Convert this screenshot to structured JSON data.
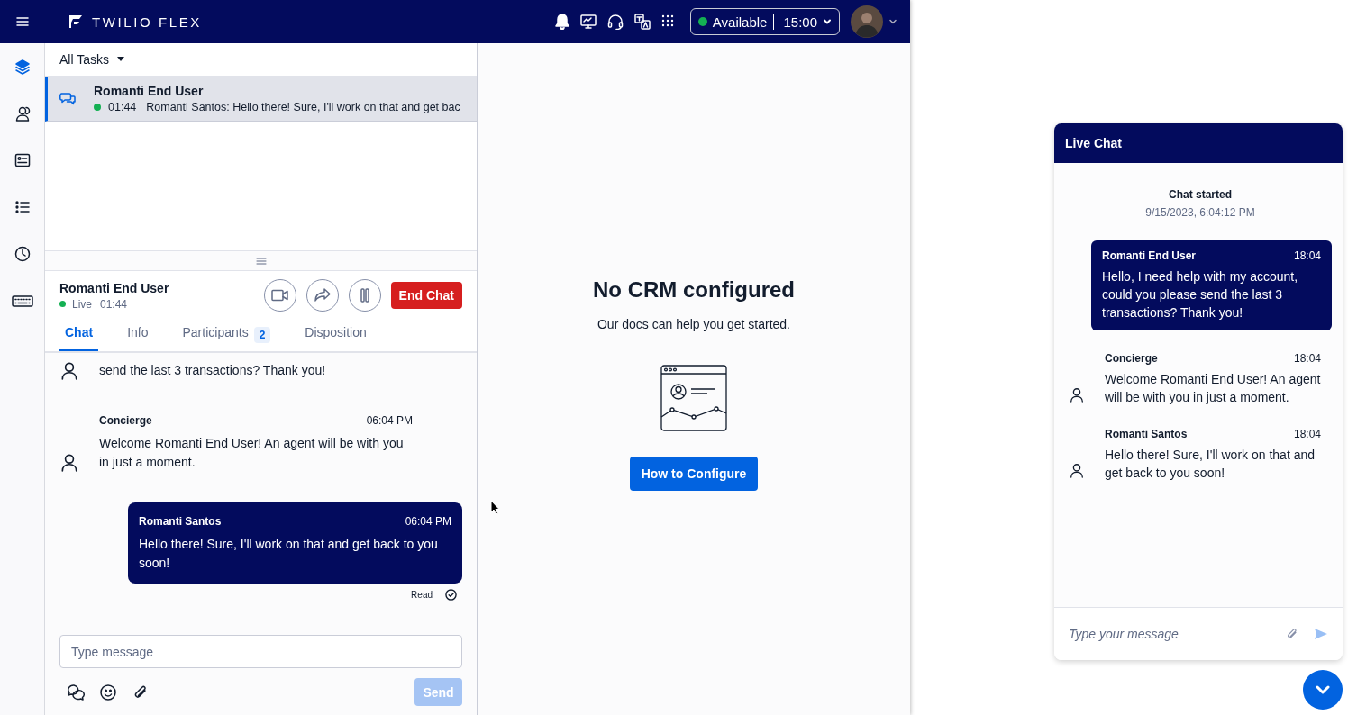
{
  "topbar": {
    "brand": "TWILIO FLEX",
    "status": {
      "label": "Available",
      "timer": "15:00",
      "available": true
    }
  },
  "sidebar": {
    "items": [
      {
        "kind": "layers",
        "selected": true
      },
      {
        "kind": "contacts",
        "selected": false
      },
      {
        "kind": "card",
        "selected": false
      },
      {
        "kind": "list",
        "selected": false
      },
      {
        "kind": "clock",
        "selected": false
      },
      {
        "kind": "keyboard",
        "selected": false
      }
    ]
  },
  "task_list": {
    "filter": "All Tasks",
    "tasks": [
      {
        "title": "Romanti End User",
        "time": "01:44",
        "preview": "Romanti Santos: Hello there! Sure, I'll work on that and get bac",
        "live": true,
        "selected": true
      }
    ]
  },
  "chat": {
    "customer": "Romanti End User",
    "status": "Live",
    "timer": "01:44",
    "live": true,
    "end_button": "End Chat",
    "tabs": [
      {
        "label": "Chat",
        "selected": true
      },
      {
        "label": "Info",
        "selected": false
      },
      {
        "label": "Participants",
        "count": "2",
        "selected": false
      },
      {
        "label": "Disposition",
        "selected": false
      }
    ],
    "messages": [
      {
        "kind": "inbound",
        "text": "send the last 3 transactions? Thank you!"
      },
      {
        "kind": "inbound",
        "author": "Concierge",
        "time": "06:04 PM",
        "text": "Welcome Romanti End User! An agent will be with you in just a moment."
      },
      {
        "kind": "outbound",
        "author": "Romanti Santos",
        "time": "06:04 PM",
        "text": "Hello there! Sure, I'll work on that and get back to you soon!",
        "receipt": "Read"
      }
    ],
    "input": {
      "placeholder": "Type message"
    },
    "send_button": {
      "label": "Send",
      "disabled": true
    }
  },
  "crm": {
    "title": "No CRM configured",
    "subtitle": "Our docs can help you get started.",
    "button": "How to Configure"
  },
  "webchat": {
    "title": "Live Chat",
    "started_label": "Chat started",
    "started_time": "9/15/2023, 6:04:12 PM",
    "messages": [
      {
        "kind": "outbound",
        "author": "Romanti End User",
        "time": "18:04",
        "text": "Hello, I need help with my account, could you please send the last 3 transactions? Thank you!"
      },
      {
        "kind": "inbound",
        "author": "Concierge",
        "time": "18:04",
        "text": "Welcome Romanti End User! An agent will be with you in just a moment."
      },
      {
        "kind": "inbound",
        "author": "Romanti Santos",
        "time": "18:04",
        "text": "Hello there! Sure, I'll work on that and get back to you soon!"
      }
    ],
    "input": {
      "placeholder": "Type your message"
    }
  }
}
